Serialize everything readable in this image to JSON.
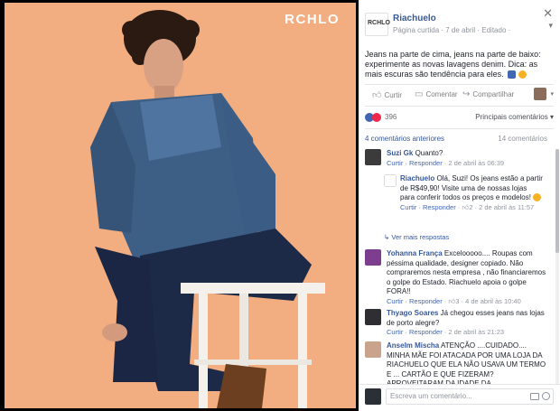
{
  "photo": {
    "brand": "RCHLO"
  },
  "post": {
    "page_name": "Riachuelo",
    "page_meta": "Página curtida · 7 de abril · Editado ·",
    "caption": "Jeans na parte de cima, jeans na parte de baixo: experimente as novas lavagens denim. Dica: as mais escuras são tendência para eles.",
    "actions": {
      "like": "Curtir",
      "comment": "Comentar",
      "share": "Compartilhar"
    },
    "reactions_count": "396",
    "sort_label": "Principais comentários ▾",
    "more_comments": "4 comentários anteriores",
    "comments_total": "14 comentários"
  },
  "comments": [
    {
      "name": "Suzi Gk",
      "text": "Quanto?",
      "meta_actions": "Curtir · Responder",
      "time": "2 de abril às 06:39",
      "avatar_color": "#3b3b3b"
    },
    {
      "reply": true,
      "name": "Riachuelo",
      "text": "Olá, Suzi! Os jeans estão a partir de R$49,90! Visite uma de nossas lojas para conferir todos os preços e modelos!",
      "meta_actions": "Curtir · Responder",
      "likes": "2",
      "time": "2 de abril às 11:57",
      "avatar_color": "#ffffff"
    },
    {
      "name": "Yohanna França",
      "text": "Excelooooo.... Roupas com péssima qualidade, designer copiado. Não compraremos nesta empresa , não financiaremos o golpe do Estado. Riachuelo apoia o golpe FORA!!",
      "meta_actions": "Curtir · Responder",
      "likes": "3",
      "time": "4 de abril às 10:40",
      "avatar_color": "#7d3e8f"
    },
    {
      "name": "Thyago Soares",
      "text": "Já chegou esses jeans nas lojas de porto alegre?",
      "meta_actions": "Curtir · Responder",
      "time": "2 de abril às 21:23",
      "avatar_color": "#2f2f33"
    },
    {
      "name": "Anselm Mischa",
      "text": "ATENÇÃO ....CUIDADO.... MINHA MÃE FOI ATACADA POR UMA LOJA DA RIACHUELO QUE ELA NÃO USAVA UM TERMO E ... CARTÃO E QUE FIZERAM? APROVEITARAM DA IDADE DA",
      "avatar_color": "#c9a38c"
    }
  ],
  "composer": {
    "placeholder": "Escreva um comentário..."
  },
  "more_replies": "↳ Ver mais respostas"
}
